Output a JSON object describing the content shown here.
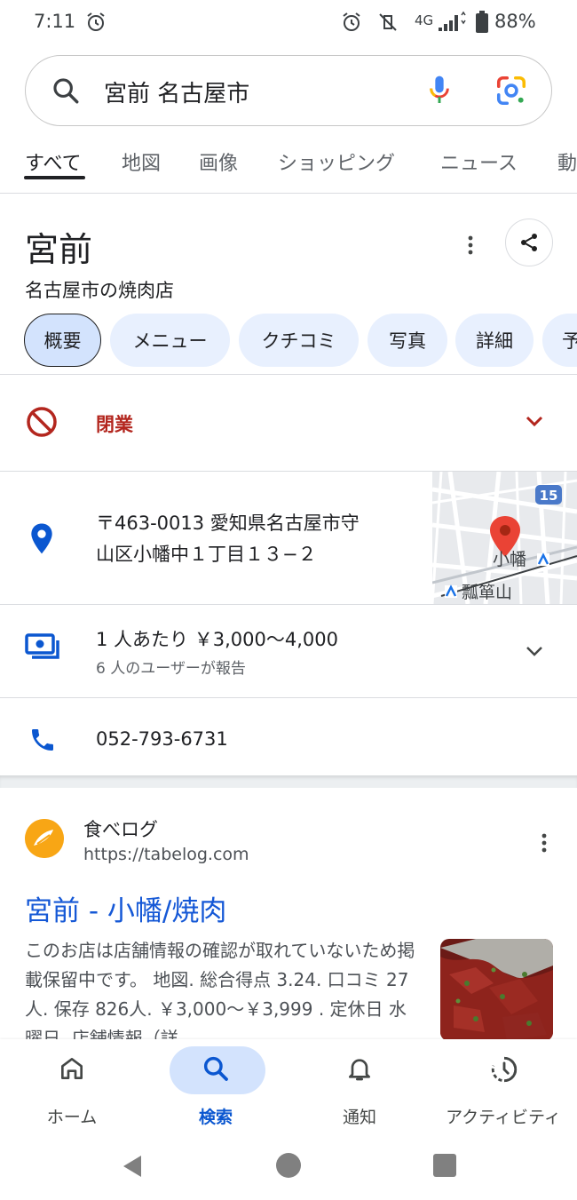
{
  "status_bar": {
    "time": "7:11",
    "network": "4G",
    "battery": "88%"
  },
  "search": {
    "query": "宮前 名古屋市"
  },
  "tabs": [
    {
      "label": "すべて",
      "active": true
    },
    {
      "label": "地図"
    },
    {
      "label": "画像"
    },
    {
      "label": "ショッピング"
    },
    {
      "label": "ニュース"
    },
    {
      "label": "動"
    }
  ],
  "knowledge_panel": {
    "title": "宮前",
    "subtitle": "名古屋市の焼肉店",
    "chips": [
      "概要",
      "メニュー",
      "クチコミ",
      "写真",
      "詳細",
      "予"
    ],
    "status": "閉業",
    "address_line1": "〒463-0013 愛知県名古屋市守",
    "address_line2": "山区小幡中１丁目１３−２",
    "map": {
      "route_badge": "15",
      "station_1": "小幡",
      "station_2": "瓢箪山"
    },
    "price": "1 人あたり ￥3,000～4,000",
    "price_note": "6 人のユーザーが報告",
    "phone": "052-793-6731"
  },
  "result": {
    "site_name": "食べログ",
    "url": "https://tabelog.com",
    "title": "宮前 - 小幡/焼肉",
    "snippet": "このお店は店舗情報の確認が取れていないため掲載保留中です。 地図. 総合得点 3.24. 口コミ 27人. 保存 826人. ￥3,000～￥3,999 . 定休日 水曜日. 店舗情報（詳..."
  },
  "bottom_nav": [
    {
      "label": "ホーム",
      "icon": "home-icon"
    },
    {
      "label": "検索",
      "icon": "search-icon",
      "active": true
    },
    {
      "label": "通知",
      "icon": "bell-icon"
    },
    {
      "label": "アクティビティ",
      "icon": "activity-icon"
    }
  ],
  "colors": {
    "accent_blue": "#0b57d0",
    "closed_red": "#b3261e",
    "link_blue": "#1558d6",
    "chip_bg": "#e8f0fe"
  }
}
